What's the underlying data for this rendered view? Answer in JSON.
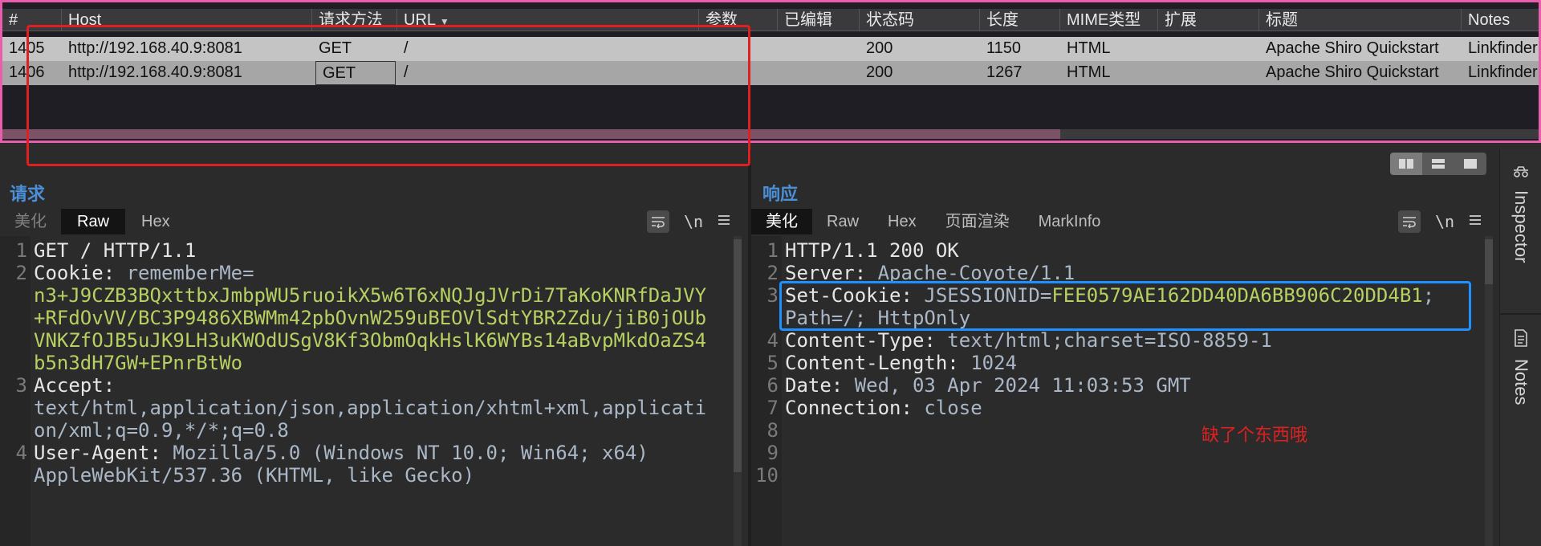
{
  "history": {
    "columns": [
      "#",
      "Host",
      "请求方法",
      "URL",
      "参数",
      "已编辑",
      "状态码",
      "长度",
      "MIME类型",
      "扩展",
      "标题",
      "Notes"
    ],
    "rows": [
      {
        "num": "1405",
        "host": "http://192.168.40.9:8081",
        "method": "GET",
        "url": "/",
        "params": "",
        "edited": "",
        "status": "200",
        "length": "1150",
        "mime": "HTML",
        "ext": "",
        "title": "Apache Shiro Quickstart",
        "notes": "Linkfinder"
      },
      {
        "num": "1406",
        "host": "http://192.168.40.9:8081",
        "method": "GET",
        "url": "/",
        "params": "",
        "edited": "",
        "status": "200",
        "length": "1267",
        "mime": "HTML",
        "ext": "",
        "title": "Apache Shiro Quickstart",
        "notes": "Linkfinder"
      }
    ]
  },
  "request": {
    "title": "请求",
    "tabs": [
      "美化",
      "Raw",
      "Hex"
    ],
    "active_tab": "Raw",
    "tools": {
      "wrap": "wrap-icon",
      "newline": "\\n",
      "menu": "menu-icon"
    },
    "lines": [
      {
        "n": "1",
        "text": "GET / HTTP/1.1"
      },
      {
        "n": "2",
        "key": "Cookie: ",
        "val": "rememberMe=",
        "cont": [
          "n3+J9CZB3BQxttbxJmbpWU5ruoikX5w6T6xNQJgJVrDi7TaKoKNRfDaJVY",
          "+RFdOvVV/BC3P9486XBWMm42pbOvnW259uBEOVlSdtYBR2Zdu/jiB0jOUb",
          "VNKZfOJB5uJK9LH3uKWOdUSgV8Kf3ObmOqkHslK6WYBs14aBvpMkdOaZS4",
          "b5n3dH7GW+EPnrBtWo"
        ]
      },
      {
        "n": "3",
        "key": "Accept:",
        "cont": [
          "text/html,application/json,application/xhtml+xml,applicati",
          "on/xml;q=0.9,*/*;q=0.8"
        ]
      },
      {
        "n": "4",
        "key": "User-Agent: ",
        "val": "Mozilla/5.0 (Windows NT 10.0; Win64; x64)",
        "cont": [
          "AppleWebKit/537.36 (KHTML, like Gecko)"
        ]
      }
    ]
  },
  "response": {
    "title": "响应",
    "tabs": [
      "美化",
      "Raw",
      "Hex",
      "页面渲染",
      "MarkInfo"
    ],
    "active_tab": "美化",
    "lines": [
      {
        "n": "1",
        "text": "HTTP/1.1 200 OK"
      },
      {
        "n": "2",
        "key": "Server: ",
        "val": "Apache-Coyote/1.1"
      },
      {
        "n": "3",
        "key": "Set-Cookie: ",
        "val": "JSESSIONID=",
        "green": "FEE0579AE162DD40DA6BB906C20DD4B1",
        "tail": ";"
      },
      {
        "n": "",
        "val": "Path=/; HttpOnly"
      },
      {
        "n": "4",
        "key": "Content-Type: ",
        "val": "text/html;charset=ISO-8859-1"
      },
      {
        "n": "5",
        "key": "Content-Length: ",
        "val": "1024"
      },
      {
        "n": "6",
        "key": "Date: ",
        "val": "Wed, 03 Apr 2024 11:03:53 GMT"
      },
      {
        "n": "7",
        "key": "Connection: ",
        "val": "close"
      },
      {
        "n": "8",
        "text": ""
      },
      {
        "n": "9",
        "text": ""
      },
      {
        "n": "10",
        "text": ""
      }
    ]
  },
  "annotation": "缺了个东西哦",
  "sidebar": {
    "inspector": "Inspector",
    "notes": "Notes"
  },
  "colors": {
    "accent": "#4a8fd8",
    "highlight_red": "#e02020",
    "highlight_blue": "#1e90ff",
    "cookie_green": "#b6d061",
    "frame_pink": "#e85dae"
  }
}
